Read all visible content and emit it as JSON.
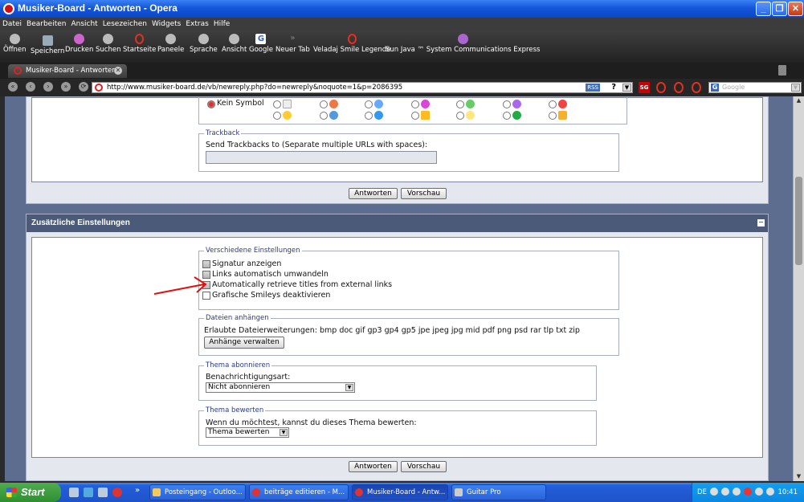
{
  "window": {
    "title": "Musiker-Board - Antworten - Opera",
    "minimize_glyph": "_",
    "maximize_glyph": "❐",
    "close_glyph": "✕"
  },
  "menu": [
    "Datei",
    "Bearbeiten",
    "Ansicht",
    "Lesezeichen",
    "Widgets",
    "Extras",
    "Hilfe"
  ],
  "toolbar": {
    "items": [
      "Öffnen",
      "Speichern",
      "Drucken",
      "Suchen",
      "Startseite",
      "Paneele",
      "Sprache",
      "Ansicht",
      "Google",
      "Neuer Tab",
      "Veladaj Smile Legende",
      "Sun Java ™ System Communications Express"
    ],
    "google_glyph": "G",
    "chevron_glyph": "»"
  },
  "tab": {
    "label": "Musiker-Board - Antworten",
    "close_glyph": "✕"
  },
  "nav": {
    "back_glyph": "«",
    "prev_glyph": "‹",
    "next_glyph": "›",
    "forward_glyph": "»",
    "reload_glyph": "⟳"
  },
  "address": {
    "url": "http://www.musiker-board.de/vb/newreply.php?do=newreply&noquote=1&p=2086395",
    "rss": "RSS",
    "help": "?",
    "dropdown_glyph": "▼",
    "ext_label": "SG",
    "search_placeholder": "Google",
    "search_logo": "G"
  },
  "upper_section": {
    "no_symbol_label": "Kein Symbol",
    "trackback_legend": "Trackback",
    "trackback_label": "Send Trackbacks to (Separate multiple URLs with spaces):",
    "submit_label": "Antworten",
    "preview_label": "Vorschau"
  },
  "additional_settings": {
    "title": "Zusätzliche Einstellungen",
    "collapse_glyph": "−",
    "misc_legend": "Verschiedene Einstellungen",
    "options": [
      {
        "label": "Signatur anzeigen",
        "checked": true
      },
      {
        "label": "Links automatisch umwandeln",
        "checked": true
      },
      {
        "label": "Automatically retrieve titles from external links",
        "checked": true
      },
      {
        "label": "Grafische Smileys deaktivieren",
        "checked": false
      }
    ],
    "attach_legend": "Dateien anhängen",
    "allowed_extensions": "Erlaubte Dateierweiterungen: bmp doc gif gp3 gp4 gp5 jpe jpeg jpg mid pdf png psd rar tlp txt zip",
    "manage_attachments": "Anhänge verwalten",
    "subscribe_legend": "Thema abonnieren",
    "notification_label": "Benachrichtigungsart:",
    "notification_value": "Nicht abonnieren",
    "rate_legend": "Thema bewerten",
    "rate_label": "Wenn du möchtest, kannst du dieses Thema bewerten:",
    "rate_value": "Thema bewerten",
    "select_arrow_glyph": "▼",
    "submit_label": "Antworten",
    "preview_label": "Vorschau"
  },
  "scrollbar": {
    "up_glyph": "▲",
    "down_glyph": "▼"
  },
  "taskbar": {
    "start": "Start",
    "more_glyph": "»",
    "tasks": [
      "Posteingang - Outloo...",
      "beiträge editieren - M...",
      "Musiker-Board - Antw...",
      "Guitar Pro"
    ],
    "language": "DE",
    "clock": "10:41"
  },
  "colors": {
    "annotation_arrow": "#e01010",
    "section_header": "#4c5a7a",
    "legend_text": "#2a3c88"
  }
}
